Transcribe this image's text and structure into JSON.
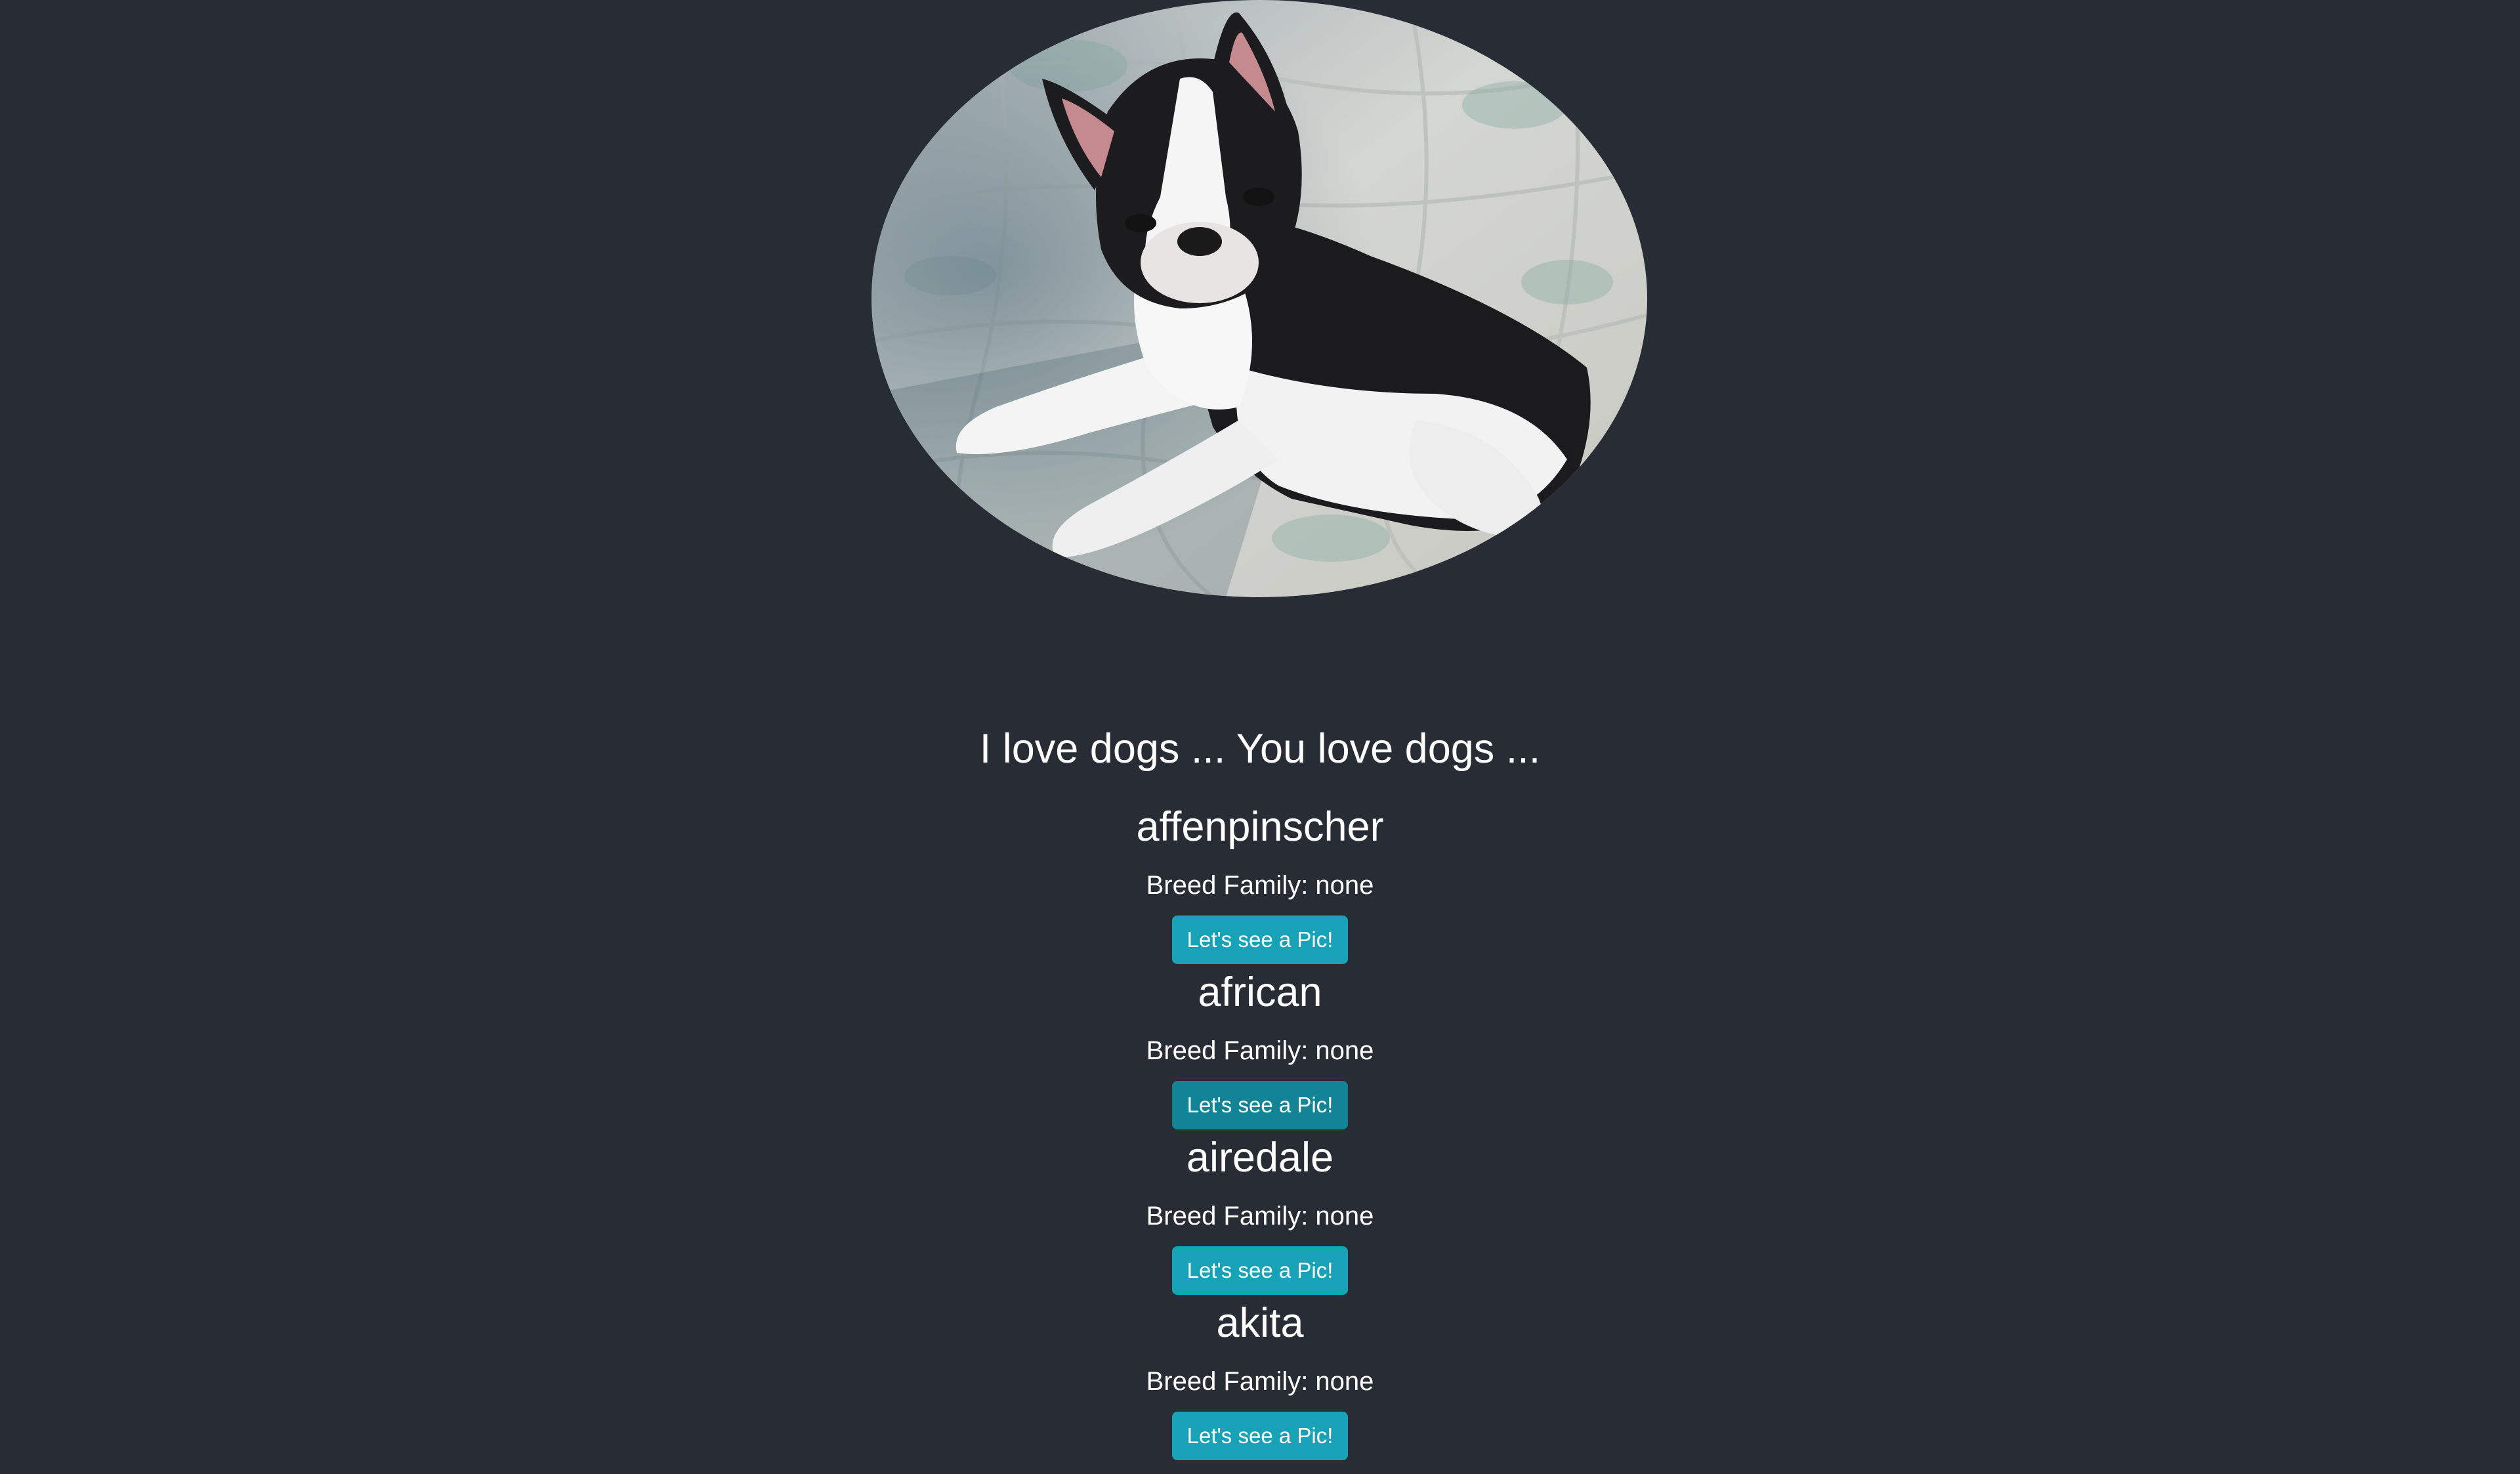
{
  "colors": {
    "background": "#282c34",
    "text": "#ffffff",
    "button": "#17a2b8",
    "button_alt": "#138496"
  },
  "hero": {
    "subject": "boston-terrier-photo"
  },
  "tagline": "I love dogs ... You love dogs ...",
  "breeds": [
    {
      "name": "affenpinscher",
      "family": "Breed Family: none",
      "button": "Let's see a Pic!"
    },
    {
      "name": "african",
      "family": "Breed Family: none",
      "button": "Let's see a Pic!"
    },
    {
      "name": "airedale",
      "family": "Breed Family: none",
      "button": "Let's see a Pic!"
    },
    {
      "name": "akita",
      "family": "Breed Family: none",
      "button": "Let's see a Pic!"
    }
  ]
}
